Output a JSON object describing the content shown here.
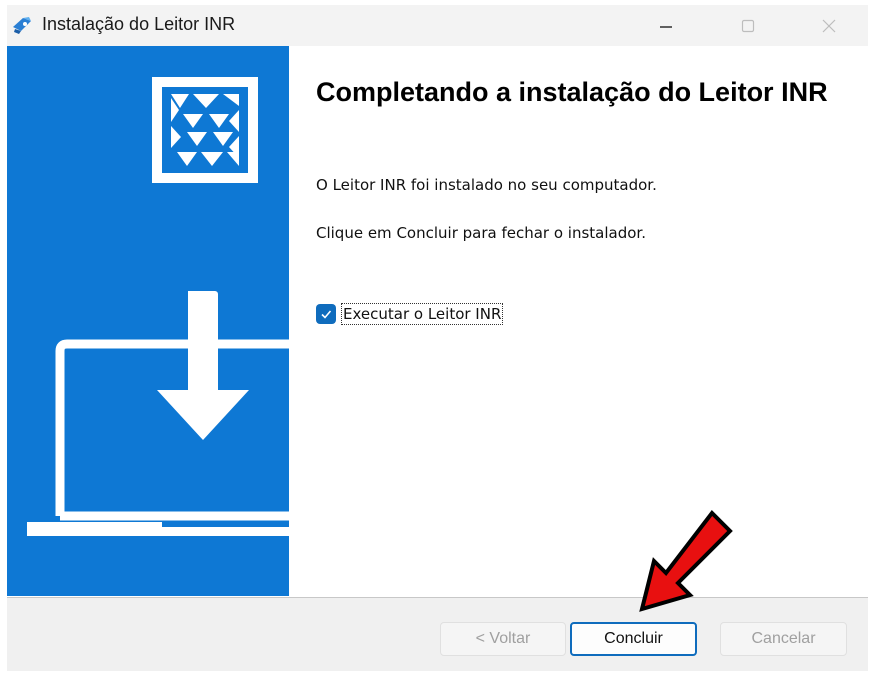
{
  "window": {
    "title": "Instalação do Leitor INR",
    "icon": "installer-app-icon"
  },
  "content": {
    "heading": "Completando a instalação do Leitor INR",
    "line1": "O Leitor INR foi instalado no seu computador.",
    "line2": "Clique em Concluir para fechar o instalador.",
    "checkbox": {
      "label": "Executar o Leitor INR",
      "checked": true
    }
  },
  "buttons": {
    "back": "< Voltar",
    "finish": "Concluir",
    "cancel": "Cancelar"
  },
  "colors": {
    "panel_blue": "#0e78d4",
    "accent": "#0f6cbd",
    "annotation_arrow": "#e81010"
  }
}
